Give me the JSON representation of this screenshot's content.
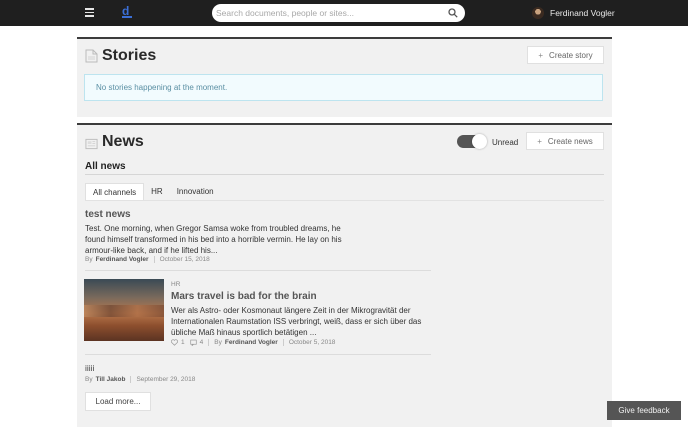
{
  "topbar": {
    "search_placeholder": "Search documents, people or sites...",
    "user_name": "Ferdinand Vogler"
  },
  "stories": {
    "title": "Stories",
    "create_label": "Create story",
    "empty_message": "No stories happening at the moment."
  },
  "news": {
    "title": "News",
    "unread_label": "Unread",
    "unread_on": true,
    "create_label": "Create news",
    "section_title": "All news",
    "tabs": [
      {
        "label": "All channels",
        "active": true
      },
      {
        "label": "HR",
        "active": false
      },
      {
        "label": "Innovation",
        "active": false
      }
    ],
    "items": [
      {
        "title": "test news",
        "body_lines": [
          "Test. One morning, when Gregor Samsa woke from troubled dreams, he",
          "found himself transformed in his bed into a horrible vermin. He lay on his",
          "armour-like back, and if he lifted his..."
        ],
        "by": "By",
        "author": "Ferdinand Vogler",
        "date": "October 15, 2018"
      },
      {
        "category": "HR",
        "title": "Mars travel is bad for the brain",
        "body_lines": [
          "Wer als Astro- oder Kosmonaut längere Zeit in der Mikrogravität der",
          "Internationalen Raumstation ISS verbringt, weiß, dass er sich über das",
          "übliche Maß hinaus sportlich betätigen ..."
        ],
        "likes": "1",
        "comments": "4",
        "by": "By",
        "author": "Ferdinand Vogler",
        "date": "October 5, 2018"
      },
      {
        "title": "iiiii",
        "by": "By",
        "author": "Till Jakob",
        "date": "September 29, 2018"
      }
    ],
    "load_more_label": "Load more..."
  },
  "feedback_label": "Give feedback",
  "colors": {
    "topbar": "#1f1f1f",
    "accent": "#3b6fd6",
    "panel": "#f1f1f1",
    "info_bg": "#f2fbfe",
    "info_border": "#bde4ef"
  }
}
